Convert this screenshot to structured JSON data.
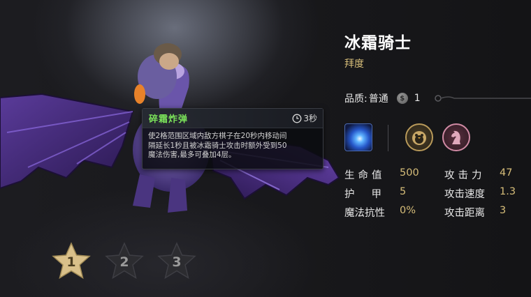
{
  "hero": {
    "name": "冰霜骑士",
    "race": "拜度",
    "quality_label": "品质:",
    "quality_value": "普通",
    "coin_symbol": "$",
    "cost": "1"
  },
  "skill": {
    "name": "碎霜炸弹",
    "cooldown": "3秒",
    "description_lines": [
      "使2格范围区域内敌方棋子在20秒内移动间",
      "隔延长1秒且被冰霜骑士攻击时额外受到50",
      "魔法伤害,最多可叠加4层。"
    ],
    "icon": "ice-bomb-icon"
  },
  "traits": [
    {
      "icon": "penguin-icon",
      "color": "#b99a5a"
    },
    {
      "icon": "knight-icon",
      "color": "#d08aa4"
    }
  ],
  "stats": {
    "hp_label": "生命值",
    "hp_value": "500",
    "atk_label": "攻击力",
    "atk_value": "47",
    "armor_label": "护甲",
    "armor_value": "5",
    "atk_speed_label": "攻击速度",
    "atk_speed_value": "1.3",
    "mr_label": "魔法抗性",
    "mr_value": "0%",
    "range_label": "攻击距离",
    "range_value": "3"
  },
  "stars": [
    "1",
    "2",
    "3"
  ],
  "colors": {
    "accent_gold": "#d6bd79",
    "skill_name_green": "#7be35a",
    "star_active": "#d9c08a",
    "star_inactive": "#2c2c30"
  }
}
